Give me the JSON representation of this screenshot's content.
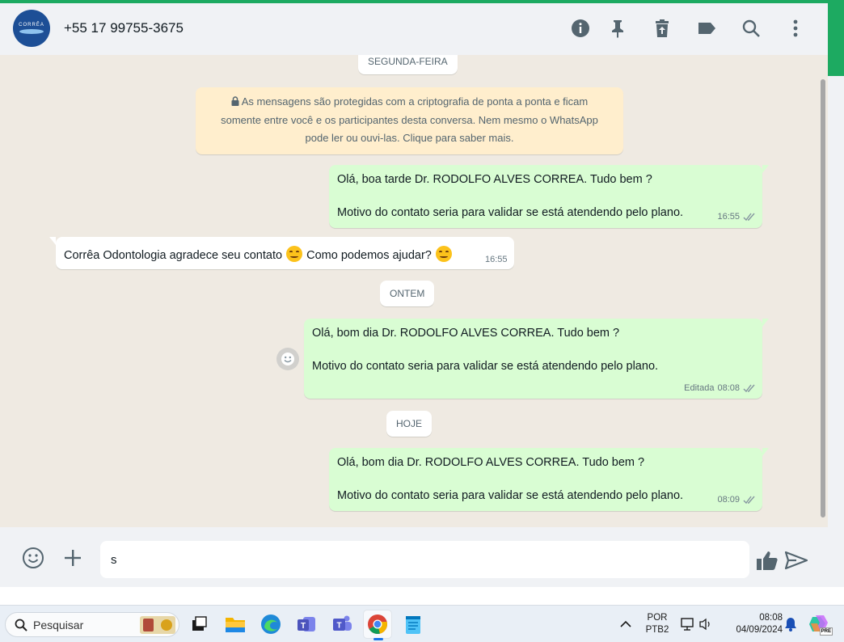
{
  "header": {
    "contact_name": "+55 17 99755-3675",
    "avatar_text": "CORRÊA",
    "icons": [
      "info-icon",
      "pin-icon",
      "delete-icon",
      "label-icon",
      "search-icon",
      "menu-icon"
    ]
  },
  "chat": {
    "day_separators": [
      "SEGUNDA-FEIRA",
      "ONTEM",
      "HOJE"
    ],
    "encryption_notice": {
      "line1": "As mensagens são protegidas com a criptografia de ponta a ponta e ficam",
      "line2": "somente entre você e os participantes desta conversa. Nem mesmo o WhatsApp",
      "line3": "pode ler ou ouvi-las. Clique para saber mais."
    },
    "messages": [
      {
        "direction": "out",
        "line1": "Olá, boa tarde Dr. RODOLFO ALVES CORREA. Tudo bem ?",
        "line2": "Motivo do contato seria para validar se está atendendo pelo plano.",
        "time": "16:55",
        "status": "read"
      },
      {
        "direction": "in",
        "text_a": "Corrêa Odontologia agradece seu contato",
        "text_b": "Como podemos ajudar?",
        "time": "16:55"
      },
      {
        "direction": "out",
        "line1": "Olá, bom dia Dr. RODOLFO ALVES CORREA. Tudo bem ?",
        "line2": "Motivo do contato seria para validar se está atendendo pelo plano.",
        "edited_label": "Editada",
        "time": "08:08",
        "status": "read"
      },
      {
        "direction": "out",
        "line1": "Olá, bom dia Dr. RODOLFO ALVES CORREA. Tudo bem ?",
        "line2": "Motivo do contato seria para validar se está atendendo pelo plano.",
        "time": "08:09",
        "status": "read"
      }
    ]
  },
  "composer": {
    "input_value": "s"
  },
  "taskbar": {
    "search_label": "Pesquisar",
    "lang_line1": "POR",
    "lang_line2": "PTB2",
    "clock_time": "08:08",
    "clock_date": "04/09/2024",
    "copilot_badge": "PRE"
  },
  "colors": {
    "accent_green": "#1daa61",
    "bubble_out": "#d9fdd3",
    "bubble_in": "#ffffff",
    "notice_bg": "#ffeecd",
    "read_ticks": "#8696a0"
  }
}
